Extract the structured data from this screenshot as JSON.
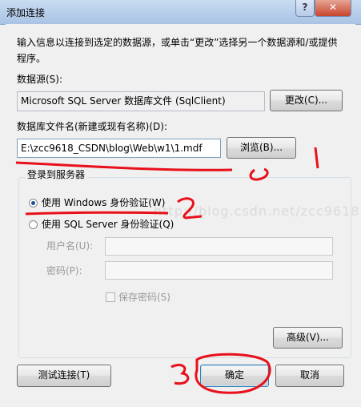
{
  "window": {
    "title": "添加连接",
    "help_glyph": "?",
    "close_glyph": "✕"
  },
  "intro_text": "输入信息以连接到选定的数据源，或单击“更改”选择另一个数据源和/或提供程序。",
  "datasource": {
    "label": "数据源(S):",
    "value": "Microsoft SQL Server 数据库文件 (SqlClient)",
    "change_button": "更改(C)..."
  },
  "dbfile": {
    "label": "数据库文件名(新建或现有名称)(D):",
    "value": "E:\\zcc9618_CSDN\\blog\\Web\\w1\\1.mdf",
    "browse_button": "浏览(B)..."
  },
  "login": {
    "group_label": "登录到服务器",
    "windows_auth": "使用 Windows 身份验证(W)",
    "sql_auth": "使用 SQL Server 身份验证(Q)",
    "username_label": "用户名(U):",
    "password_label": "密码(P):",
    "save_password": "保存密码(S)"
  },
  "advanced_button": "高级(V)...",
  "test_button": "测试连接(T)",
  "ok_button": "确定",
  "cancel_button": "取消",
  "annotations": {
    "mark1": "1",
    "mark2": "2",
    "mark3": "3"
  },
  "watermark": "http://blog.csdn.net/zcc9618",
  "colors": {
    "annotation_red": "#e8101a",
    "title_bar": "#b9cfeb",
    "dialog_bg": "#f0f0f0"
  }
}
